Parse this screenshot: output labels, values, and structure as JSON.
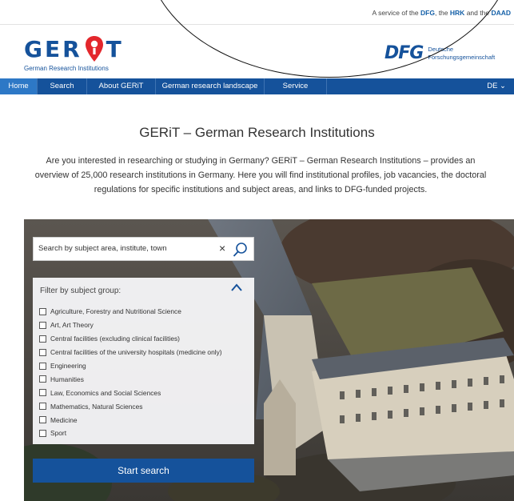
{
  "topbar": {
    "service_prefix": "A service of the",
    "dfg": "DFG",
    "sep": ", the",
    "hrk": "HRK",
    "and": "and the",
    "daad": "DAAD"
  },
  "logo": {
    "letters_left": "GER",
    "letters_right": "T",
    "subtitle": "German Research Institutions"
  },
  "dfg_logo": {
    "mark": "DFG",
    "line1": "Deutsche",
    "line2": "Forschungsgemeinschaft"
  },
  "nav": {
    "items": [
      {
        "label": "Home",
        "active": true
      },
      {
        "label": "Search"
      },
      {
        "label": "About GERiT"
      },
      {
        "label": "German research landscape"
      },
      {
        "label": "Service"
      }
    ],
    "language": "DE ⌄"
  },
  "main": {
    "title": "GERiT – German Research Institutions",
    "intro": "Are you interested in researching or studying in Germany? GERiT – German Research Institutions – provides an overview of 25,000 research institutions in Germany. Here you will find institutional profiles, job vacancies, the doctoral regulations for specific institutions and subject areas, and links to DFG-funded projects."
  },
  "search": {
    "placeholder": "Search by subject area, institute, town",
    "clear_symbol": "×",
    "icon": "search-icon"
  },
  "filter": {
    "heading": "Filter by subject group:",
    "options": [
      "Agriculture, Forestry and Nutritional Science",
      "Art, Art Theory",
      "Central facilities (excluding clinical facilities)",
      "Central facilities of the university hospitals (medicine only)",
      "Engineering",
      "Humanities",
      "Law, Economics and Social Sciences",
      "Mathematics, Natural Sciences",
      "Medicine",
      "Sport"
    ]
  },
  "start_button": "Start search",
  "colors": {
    "brand_blue": "#15529b",
    "nav_active": "#2d78c6",
    "logo_red": "#e3272c"
  }
}
